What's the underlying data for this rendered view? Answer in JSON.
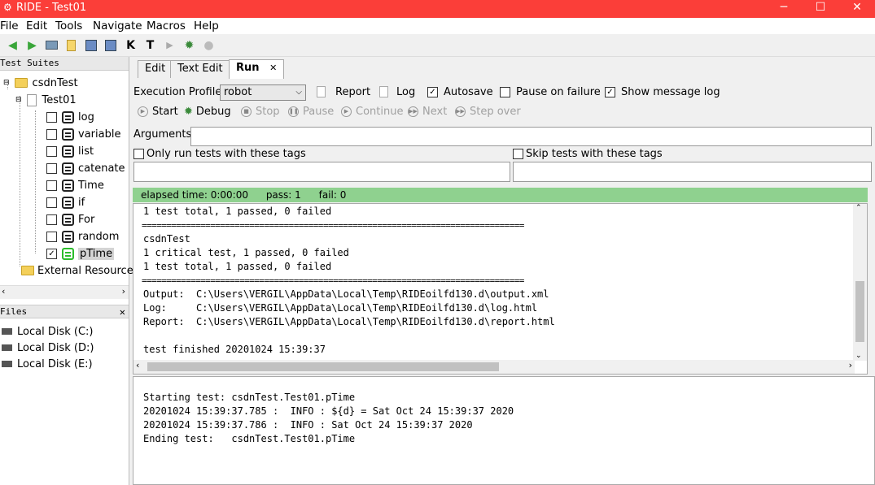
{
  "window": {
    "app_icon": "robot-icon",
    "title": "RIDE - Test01",
    "controls": {
      "minimize": "─",
      "maximize": "☐",
      "close": "✕"
    }
  },
  "menu": [
    "File",
    "Edit",
    "Tools",
    "Navigate",
    "Macros",
    "Help"
  ],
  "toolbar": {
    "icons": [
      "back-arrow-icon",
      "forward-arrow-icon",
      "open-folder-icon",
      "new-file-icon",
      "save-icon",
      "save-all-icon",
      "search-keywords-icon",
      "search-tests-icon",
      "run-icon",
      "debug-icon",
      "stop-icon"
    ],
    "search_keywords_glyph": "K",
    "search_tests_glyph": "T"
  },
  "test_suites": {
    "header": "Test Suites",
    "root": "csdnTest",
    "suite": "Test01",
    "tests": [
      {
        "name": "log",
        "checked": false
      },
      {
        "name": "variable",
        "checked": false
      },
      {
        "name": "list",
        "checked": false
      },
      {
        "name": "catenate",
        "checked": false
      },
      {
        "name": "Time",
        "checked": false
      },
      {
        "name": "if",
        "checked": false
      },
      {
        "name": "For",
        "checked": false
      },
      {
        "name": "random",
        "checked": false
      },
      {
        "name": "pTime",
        "checked": true
      }
    ],
    "external_resources": "External Resources"
  },
  "files": {
    "header": "Files",
    "close": "✕",
    "drives": [
      "Local Disk (C:)",
      "Local Disk (D:)",
      "Local Disk (E:)"
    ]
  },
  "tabs": [
    {
      "label": "Edit",
      "active": false
    },
    {
      "label": "Text Edit",
      "active": false
    },
    {
      "label": "Run",
      "active": true,
      "close": "✕"
    }
  ],
  "run": {
    "execution_profile_label": "Execution Profile:",
    "execution_profile_value": "robot",
    "report": "Report",
    "log": "Log",
    "autosave": {
      "label": "Autosave",
      "checked": true
    },
    "pause_on_failure": {
      "label": "Pause on failure",
      "checked": false
    },
    "show_message_log": {
      "label": "Show message log",
      "checked": true
    },
    "buttons": {
      "start": "Start",
      "debug": "Debug",
      "stop": "Stop",
      "pause": "Pause",
      "continue": "Continue",
      "next": "Next",
      "step_over": "Step over"
    },
    "arguments_label": "Arguments:",
    "only_run_tags": "Only run tests with these tags",
    "skip_tags": "Skip tests with these tags",
    "status": {
      "elapsed": "elapsed time: 0:00:00",
      "pass": "pass: 1",
      "fail": "fail: 0"
    },
    "output_lines": [
      "1 test total, 1 passed, 0 failed",
      "==============================================================================",
      "csdnTest",
      "1 critical test, 1 passed, 0 failed",
      "1 test total, 1 passed, 0 failed",
      "==============================================================================",
      "Output:  C:\\Users\\VERGIL\\AppData\\Local\\Temp\\RIDEoilfd130.d\\output.xml",
      "Log:     C:\\Users\\VERGIL\\AppData\\Local\\Temp\\RIDEoilfd130.d\\log.html",
      "Report:  C:\\Users\\VERGIL\\AppData\\Local\\Temp\\RIDEoilfd130.d\\report.html",
      "",
      "test finished 20201024 15:39:37"
    ],
    "message_log": [
      "Starting test: csdnTest.Test01.pTime",
      "20201024 15:39:37.785 :  INFO : ${d} = Sat Oct 24 15:39:37 2020",
      "20201024 15:39:37.786 :  INFO : Sat Oct 24 15:39:37 2020",
      "Ending test:   csdnTest.Test01.pTime"
    ]
  }
}
